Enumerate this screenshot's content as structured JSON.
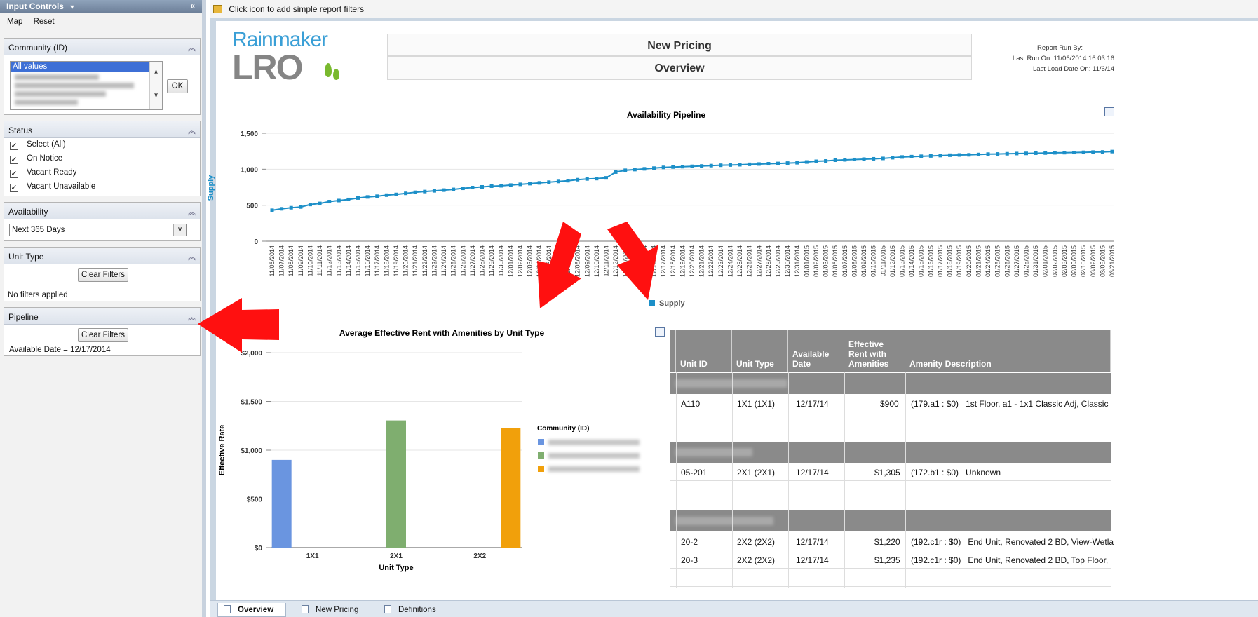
{
  "sidebar": {
    "title": "Input Controls",
    "menu": [
      "Map",
      "Reset"
    ],
    "community": {
      "label": "Community (ID)",
      "selected": "All values",
      "ok": "OK"
    },
    "status": {
      "label": "Status",
      "items": [
        "Select (All)",
        "On Notice",
        "Vacant Ready",
        "Vacant Unavailable"
      ]
    },
    "availability": {
      "label": "Availability",
      "value": "Next 365 Days"
    },
    "unit_type": {
      "label": "Unit Type",
      "clear": "Clear Filters",
      "note": "No filters applied"
    },
    "pipeline": {
      "label": "Pipeline",
      "clear": "Clear Filters",
      "note": "Available Date = 12/17/2014"
    }
  },
  "topbar": {
    "hint": "Click icon to add simple report filters"
  },
  "header": {
    "logo_top": "Rainmaker",
    "logo_bottom": "LRO",
    "title": "New Pricing",
    "subtitle": "Overview",
    "run_by": "Report Run By:",
    "last_run": "Last Run On: 11/06/2014 16:03:16",
    "last_load": "Last Load Date On: 11/6/14"
  },
  "chart_data": [
    {
      "type": "line",
      "title": "Availability Pipeline",
      "ylabel": "Supply",
      "ylim": [
        0,
        1500
      ],
      "yticks": [
        "1,500",
        "1,000",
        "500",
        "0"
      ],
      "legend": "Supply",
      "x": [
        "11/06/2014",
        "11/07/2014",
        "11/08/2014",
        "11/09/2014",
        "11/10/2014",
        "11/11/2014",
        "11/12/2014",
        "11/13/2014",
        "11/14/2014",
        "11/15/2014",
        "11/16/2014",
        "11/17/2014",
        "11/18/2014",
        "11/19/2014",
        "11/20/2014",
        "11/21/2014",
        "11/22/2014",
        "11/23/2014",
        "11/24/2014",
        "11/25/2014",
        "11/26/2014",
        "11/27/2014",
        "11/28/2014",
        "11/29/2014",
        "11/30/2014",
        "12/01/2014",
        "12/02/2014",
        "12/03/2014",
        "12/04/2014",
        "12/05/2014",
        "12/06/2014",
        "12/07/2014",
        "12/08/2014",
        "12/09/2014",
        "12/10/2014",
        "12/11/2014",
        "12/12/2014",
        "12/13/2014",
        "12/14/2014",
        "12/15/2014",
        "12/16/2014",
        "12/17/2014",
        "12/18/2014",
        "12/19/2014",
        "12/20/2014",
        "12/21/2014",
        "12/22/2014",
        "12/23/2014",
        "12/24/2014",
        "12/25/2014",
        "12/26/2014",
        "12/27/2014",
        "12/28/2014",
        "12/29/2014",
        "12/30/2014",
        "12/31/2014",
        "01/01/2015",
        "01/02/2015",
        "01/03/2015",
        "01/06/2015",
        "01/07/2015",
        "01/08/2015",
        "01/09/2015",
        "01/10/2015",
        "01/11/2015",
        "01/12/2015",
        "01/13/2015",
        "01/14/2015",
        "01/15/2015",
        "01/16/2015",
        "01/17/2015",
        "01/18/2015",
        "01/19/2015",
        "01/20/2015",
        "01/21/2015",
        "01/24/2015",
        "01/25/2015",
        "01/26/2015",
        "01/27/2015",
        "01/28/2015",
        "01/31/2015",
        "02/01/2015",
        "02/02/2015",
        "02/03/2015",
        "02/09/2015",
        "02/10/2015",
        "03/02/2015",
        "03/05/2015",
        "03/21/2015"
      ],
      "values": [
        430,
        450,
        465,
        475,
        510,
        525,
        550,
        565,
        580,
        600,
        615,
        625,
        640,
        650,
        665,
        680,
        690,
        700,
        710,
        720,
        735,
        745,
        755,
        765,
        770,
        780,
        790,
        800,
        810,
        820,
        830,
        840,
        855,
        865,
        870,
        880,
        960,
        985,
        995,
        1005,
        1015,
        1025,
        1030,
        1035,
        1040,
        1045,
        1050,
        1055,
        1058,
        1062,
        1068,
        1072,
        1076,
        1080,
        1085,
        1090,
        1100,
        1110,
        1115,
        1125,
        1130,
        1135,
        1140,
        1145,
        1150,
        1160,
        1170,
        1175,
        1180,
        1185,
        1190,
        1195,
        1198,
        1200,
        1205,
        1210,
        1212,
        1215,
        1218,
        1220,
        1223,
        1225,
        1228,
        1230,
        1232,
        1235,
        1238,
        1240,
        1245
      ]
    },
    {
      "type": "bar",
      "title": "Average Effective Rent with Amenities by Unit Type",
      "xlabel": "Unit Type",
      "ylabel": "Effective Rate",
      "ylim": [
        0,
        2000
      ],
      "yticks": [
        "$2,000",
        "$1,500",
        "$1,000",
        "$500",
        "$0"
      ],
      "categories": [
        "1X1",
        "2X1",
        "2X2"
      ],
      "legend_title": "Community (ID)",
      "series": [
        {
          "color": "#6a95e0",
          "values": [
            900,
            null,
            null
          ]
        },
        {
          "color": "#7fae6f",
          "values": [
            null,
            1305,
            null
          ]
        },
        {
          "color": "#f1a00b",
          "values": [
            null,
            null,
            1228
          ]
        }
      ]
    }
  ],
  "table": {
    "headers": [
      "Unit ID",
      "Unit Type",
      "Available Date",
      "Effective Rent with Amenities",
      "Amenity Description"
    ],
    "groups": [
      {
        "rows": [
          [
            "A110",
            "1X1 (1X1)",
            "12/17/14",
            "$900",
            "(179.a1 : $0)   1st Floor, a1 - 1x1 Classic Adj, Classic"
          ]
        ]
      },
      {
        "rows": [
          [
            "05-201",
            "2X1 (2X1)",
            "12/17/14",
            "$1,305",
            "(172.b1 : $0)   Unknown"
          ]
        ]
      },
      {
        "rows": [
          [
            "20-2",
            "2X2 (2X2)",
            "12/17/14",
            "$1,220",
            "(192.c1r : $0)   End Unit, Renovated 2 BD, View-Wetla"
          ],
          [
            "20-3",
            "2X2 (2X2)",
            "12/17/14",
            "$1,235",
            "(192.c1r : $0)   End Unit, Renovated 2 BD, Top Floor,"
          ]
        ]
      }
    ]
  },
  "tabs": [
    "Overview",
    "New Pricing",
    "Definitions"
  ],
  "colors": {
    "line": "#1c8fc8",
    "arrow": "#ff1010",
    "sidebar_header": "#7d90a8"
  }
}
